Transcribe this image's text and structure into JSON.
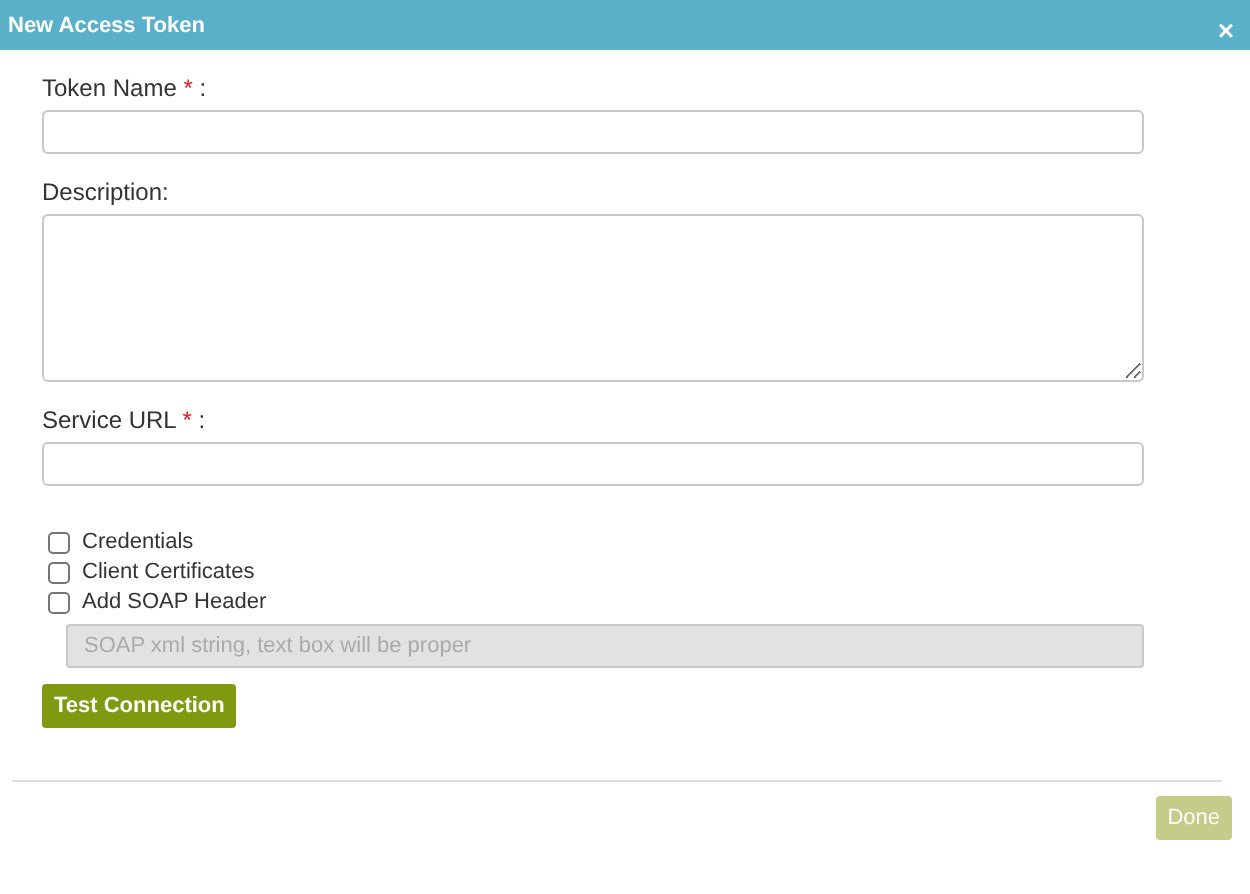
{
  "dialog": {
    "title": "New Access Token",
    "close": "×"
  },
  "fields": [
    {
      "kind": "input",
      "label": "Token Name",
      "required": true,
      "suffix": ":"
    },
    {
      "kind": "textarea",
      "label": "Description:",
      "required": false
    },
    {
      "kind": "input",
      "label": "Service URL",
      "required": true,
      "suffix": ":"
    }
  ],
  "required_mark": "*",
  "options": [
    {
      "label": "Credentials",
      "checked": false
    },
    {
      "label": "Client Certificates",
      "checked": false
    },
    {
      "label": "Add SOAP Header",
      "checked": false
    }
  ],
  "soap_field": {
    "placeholder": "SOAP xml string, text box will be proper",
    "disabled": true
  },
  "test_button": {
    "label": "Test Connection"
  },
  "done_button": {
    "label": "Done",
    "disabled": true
  }
}
